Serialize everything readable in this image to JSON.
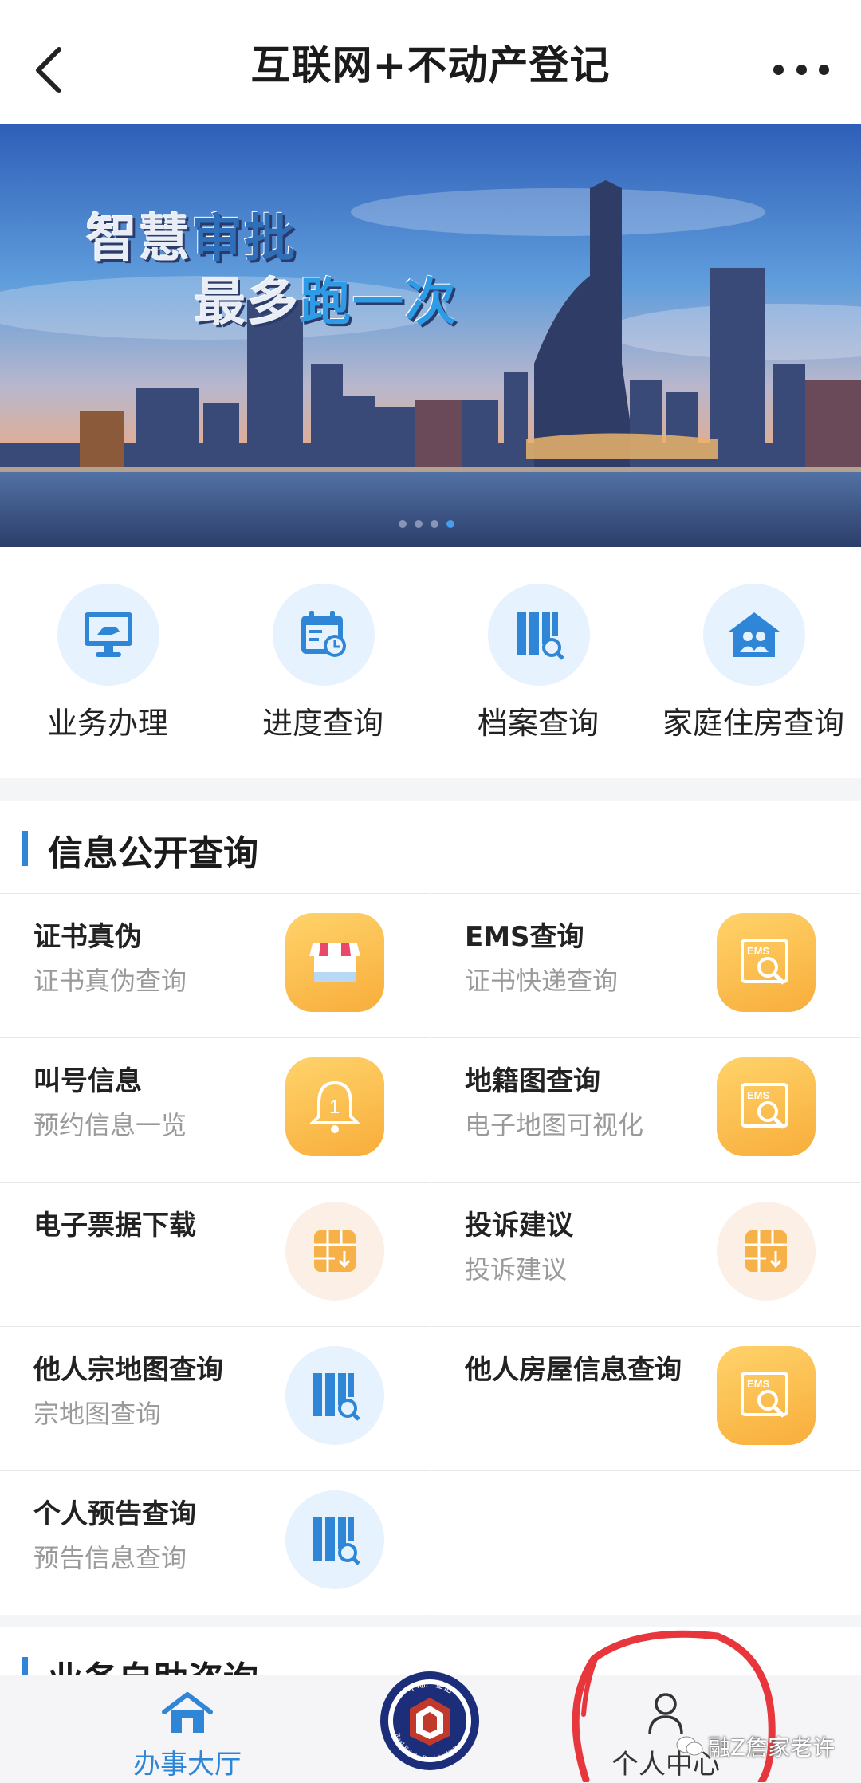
{
  "header": {
    "title": "互联网+不动产登记"
  },
  "banner": {
    "slogan_line1_a": "智慧",
    "slogan_line1_b": "审批",
    "slogan_line2_a": "最多",
    "slogan_line2_b": "跑一次",
    "page_count": 4,
    "active_index": 3
  },
  "quick_nav": [
    {
      "label": "业务办理",
      "icon": "monitor-hand-icon"
    },
    {
      "label": "进度查询",
      "icon": "calendar-clock-icon"
    },
    {
      "label": "档案查询",
      "icon": "archive-search-icon"
    },
    {
      "label": "家庭住房查询",
      "icon": "house-family-icon"
    }
  ],
  "info_section": {
    "title": "信息公开查询",
    "items": [
      {
        "title": "证书真伪",
        "subtitle": "证书真伪查询",
        "icon": "storefront-icon"
      },
      {
        "title": "EMS查询",
        "subtitle": "证书快递查询",
        "icon": "ems-search-icon"
      },
      {
        "title": "叫号信息",
        "subtitle": "预约信息一览",
        "icon": "bell-number-icon",
        "bell_number": "1"
      },
      {
        "title": "地籍图查询",
        "subtitle": "电子地图可视化",
        "icon": "ems-search-icon"
      },
      {
        "title": "电子票据下载",
        "subtitle": "",
        "icon": "grid-download-icon"
      },
      {
        "title": "投诉建议",
        "subtitle": "投诉建议",
        "icon": "grid-download-icon"
      },
      {
        "title": "他人宗地图查询",
        "subtitle": "宗地图查询",
        "icon": "archive-search-icon"
      },
      {
        "title": "他人房屋信息查询",
        "subtitle": "",
        "icon": "ems-search-icon"
      },
      {
        "title": "个人预告查询",
        "subtitle": "预告信息查询",
        "icon": "archive-search-icon"
      }
    ],
    "icon_text_ems": "EMS"
  },
  "next_section_peek": "业务自助咨询",
  "tabbar": {
    "home_label": "办事大厅",
    "logo_top_text": "不动产登记",
    "logo_bottom_text": "Real Estate Registration",
    "me_label": "个人中心"
  },
  "watermark": "融Z詹家老许",
  "colors": {
    "accent_blue": "#2f86d6",
    "icon_orange": "#f8ad3a",
    "annotation_red": "#e8373c"
  }
}
